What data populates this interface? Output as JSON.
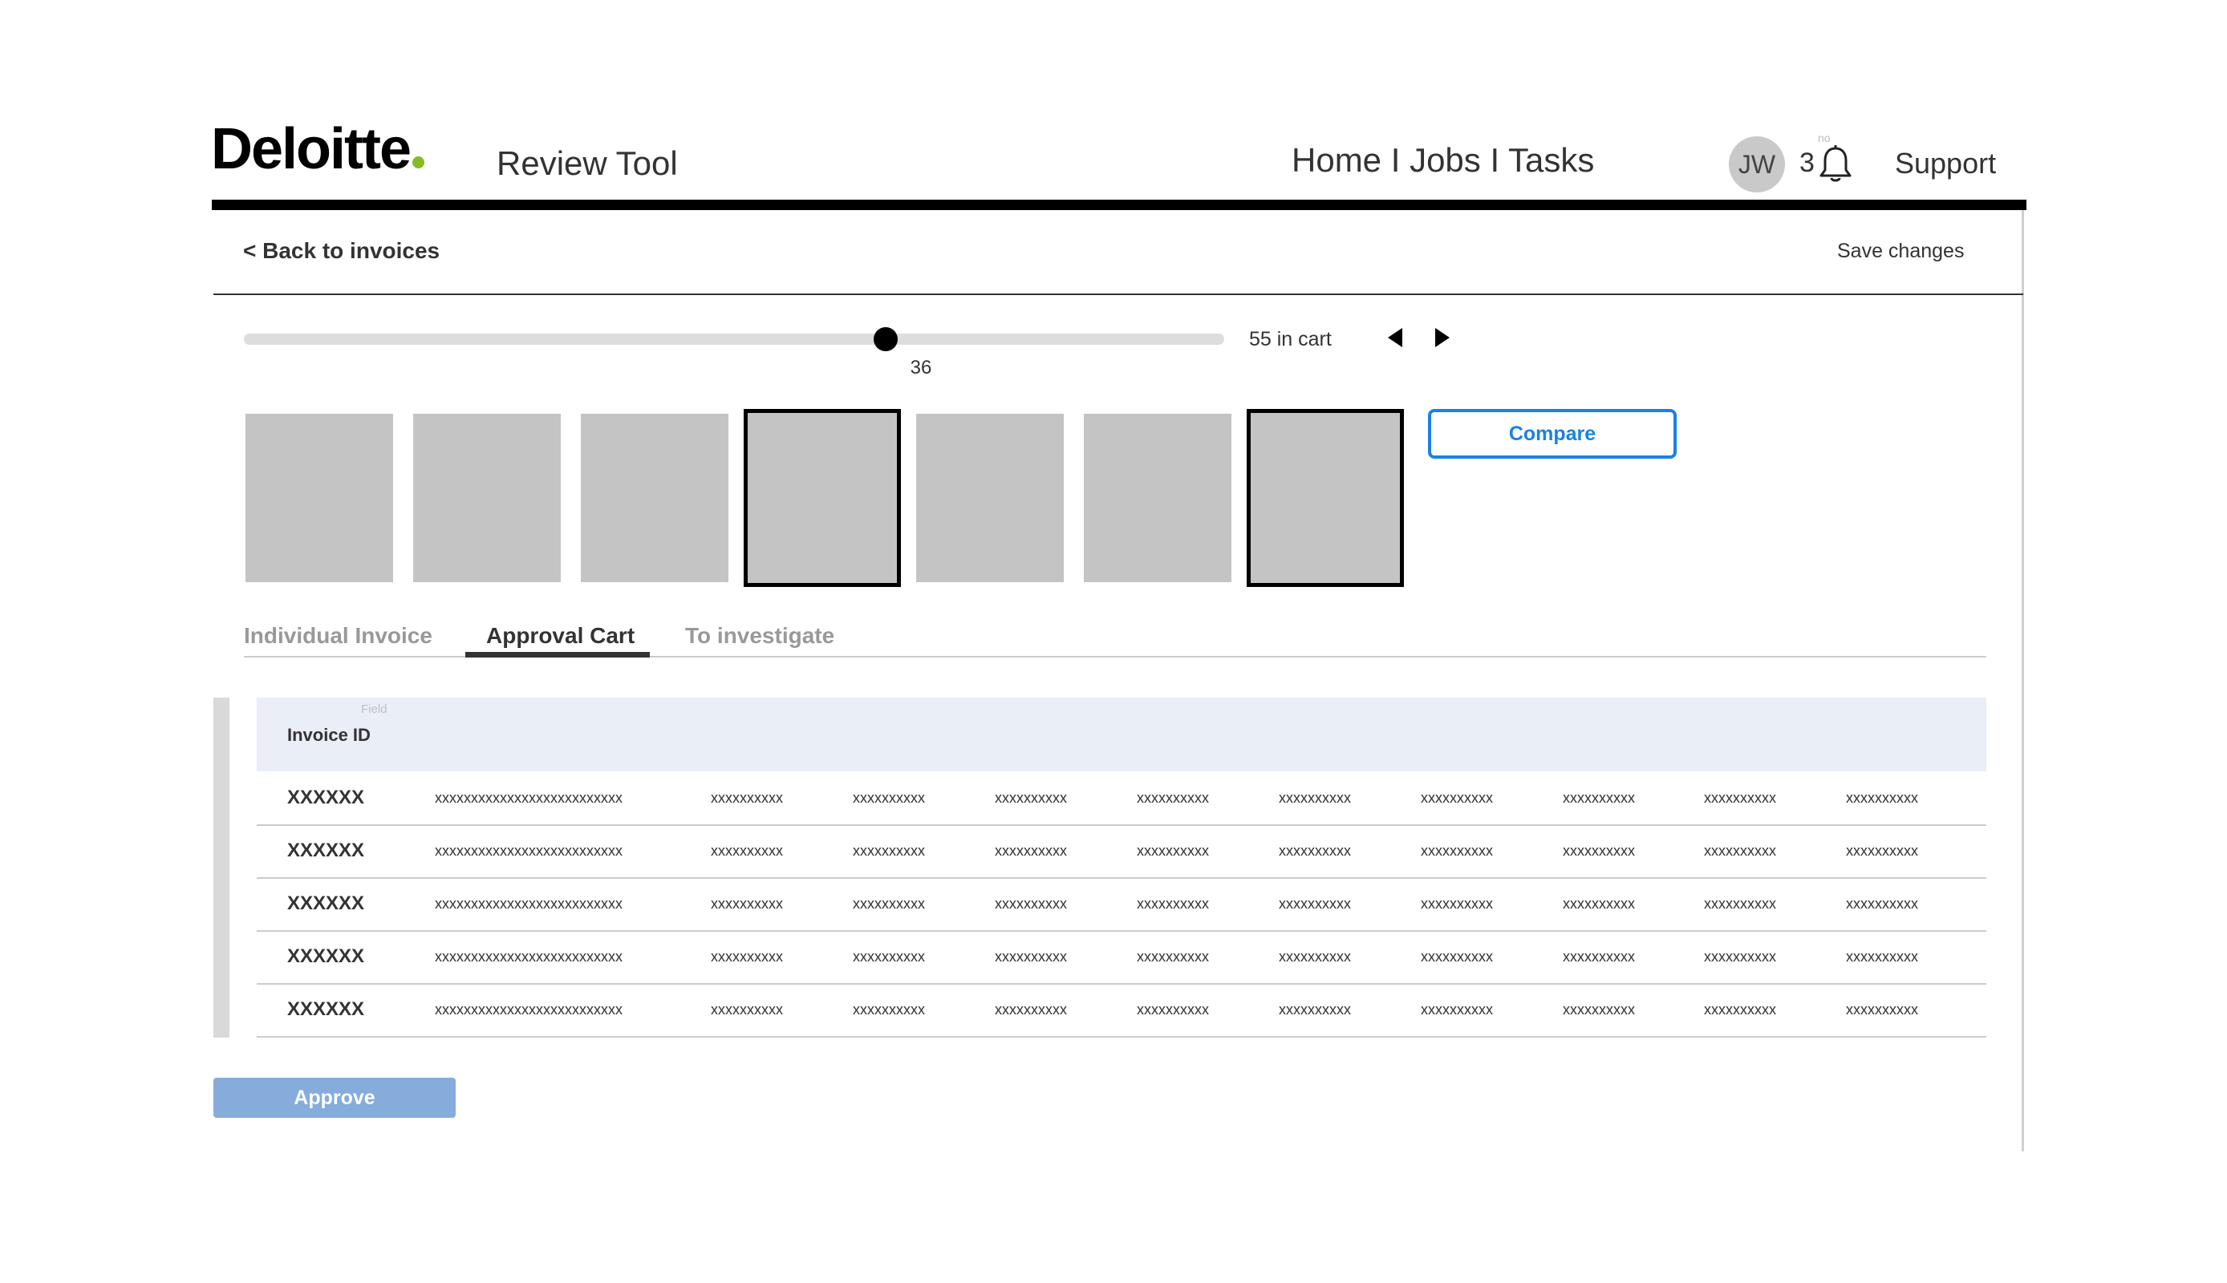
{
  "header": {
    "logo_text": "Deloitte",
    "app_title": "Review Tool",
    "nav": {
      "home": "Home",
      "jobs": "Jobs",
      "tasks": "Tasks",
      "separator": "I"
    },
    "avatar_initials": "JW",
    "notification_count": "3",
    "notification_tiny_label": "no",
    "support": "Support"
  },
  "subheader": {
    "back_link": "< Back to invoices",
    "save_changes": "Save changes"
  },
  "slider": {
    "value": "36",
    "min": 0,
    "max": 55,
    "cart_label": "55 in cart"
  },
  "thumbnails": [
    {
      "selected": false
    },
    {
      "selected": false
    },
    {
      "selected": false
    },
    {
      "selected": true
    },
    {
      "selected": false
    },
    {
      "selected": false
    },
    {
      "selected": true
    }
  ],
  "compare_button": "Compare",
  "tabs": [
    {
      "label": "Individual Invoice",
      "active": false
    },
    {
      "label": "Approval Cart",
      "active": true
    },
    {
      "label": "To investigate",
      "active": false
    }
  ],
  "table": {
    "header_tiny_label": "Field",
    "header_invoice_id": "Invoice ID",
    "rows": [
      {
        "cells": [
          "XXXXXX",
          "xxxxxxxxxxxxxxxxxxxxxxxxxx",
          "xxxxxxxxxx",
          "xxxxxxxxxx",
          "xxxxxxxxxx",
          "xxxxxxxxxx",
          "xxxxxxxxxx",
          "xxxxxxxxxx",
          "xxxxxxxxxx",
          "xxxxxxxxxx",
          "xxxxxxxxxx"
        ]
      },
      {
        "cells": [
          "XXXXXX",
          "xxxxxxxxxxxxxxxxxxxxxxxxxx",
          "xxxxxxxxxx",
          "xxxxxxxxxx",
          "xxxxxxxxxx",
          "xxxxxxxxxx",
          "xxxxxxxxxx",
          "xxxxxxxxxx",
          "xxxxxxxxxx",
          "xxxxxxxxxx",
          "xxxxxxxxxx"
        ]
      },
      {
        "cells": [
          "XXXXXX",
          "xxxxxxxxxxxxxxxxxxxxxxxxxx",
          "xxxxxxxxxx",
          "xxxxxxxxxx",
          "xxxxxxxxxx",
          "xxxxxxxxxx",
          "xxxxxxxxxx",
          "xxxxxxxxxx",
          "xxxxxxxxxx",
          "xxxxxxxxxx",
          "xxxxxxxxxx"
        ]
      },
      {
        "cells": [
          "XXXXXX",
          "xxxxxxxxxxxxxxxxxxxxxxxxxx",
          "xxxxxxxxxx",
          "xxxxxxxxxx",
          "xxxxxxxxxx",
          "xxxxxxxxxx",
          "xxxxxxxxxx",
          "xxxxxxxxxx",
          "xxxxxxxxxx",
          "xxxxxxxxxx",
          "xxxxxxxxxx"
        ]
      },
      {
        "cells": [
          "XXXXXX",
          "xxxxxxxxxxxxxxxxxxxxxxxxxx",
          "xxxxxxxxxx",
          "xxxxxxxxxx",
          "xxxxxxxxxx",
          "xxxxxxxxxx",
          "xxxxxxxxxx",
          "xxxxxxxxxx",
          "xxxxxxxxxx",
          "xxxxxxxxxx",
          "xxxxxxxxxx"
        ]
      }
    ]
  },
  "approve_button": "Approve",
  "colors": {
    "brand_green": "#86BC25",
    "accent_blue": "#1a82e2",
    "approve_blue": "#86acdc",
    "table_header_bg": "#eaeef7",
    "thumbnail_gray": "#c4c4c4"
  },
  "icons": {
    "bell": "bell-icon",
    "prev": "caret-left-icon",
    "next": "caret-right-icon"
  }
}
